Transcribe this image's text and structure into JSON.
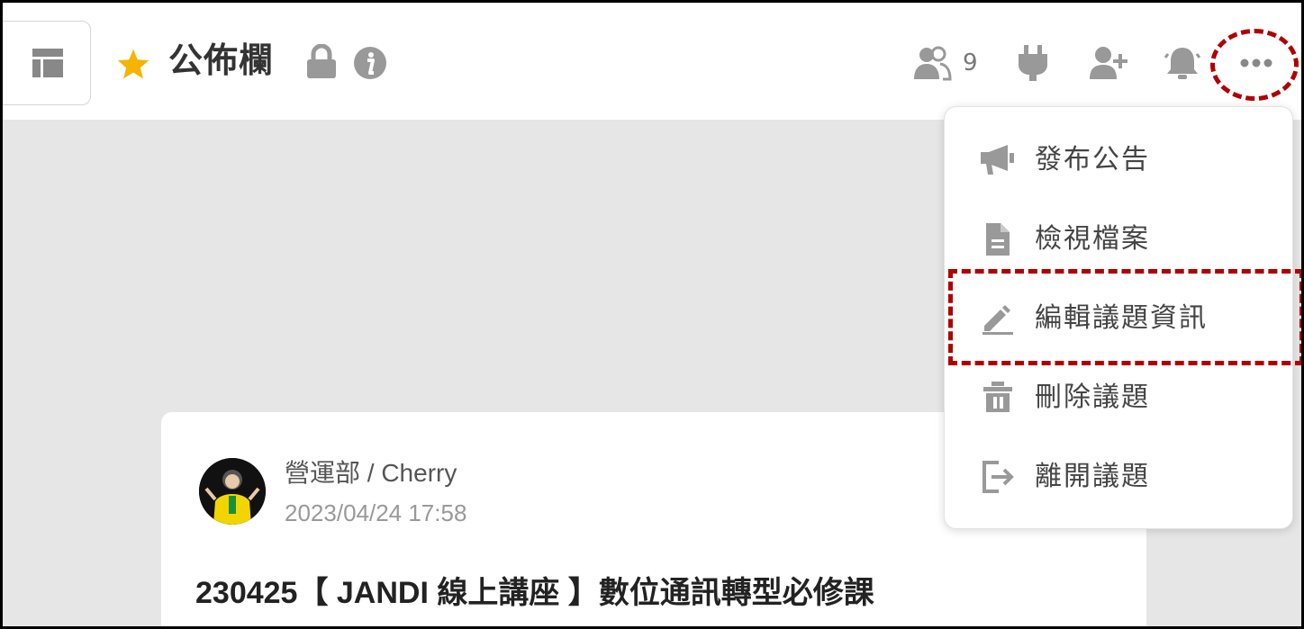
{
  "header": {
    "title": "公佈欄",
    "member_count": "9",
    "icons": [
      "layout-icon",
      "star-icon",
      "lock-icon",
      "info-icon",
      "members-icon",
      "plug-icon",
      "add-member-icon",
      "bell-icon",
      "more-icon"
    ]
  },
  "menu": {
    "items": [
      {
        "label": "發布公告",
        "icon": "megaphone-icon"
      },
      {
        "label": "檢視檔案",
        "icon": "file-icon"
      },
      {
        "label": "編輯議題資訊",
        "icon": "edit-icon"
      },
      {
        "label": "刪除議題",
        "icon": "trash-icon"
      },
      {
        "label": "離開議題",
        "icon": "exit-icon"
      }
    ]
  },
  "post": {
    "author": "營運部 / Cherry",
    "timestamp": "2023/04/24 17:58",
    "title": "230425【 JANDI 線上講座 】數位通訊轉型必修課"
  },
  "colors": {
    "accent_star": "#f5b400",
    "highlight": "#b00000",
    "icon_gray": "#999999",
    "content_bg": "#e6e6e6"
  }
}
